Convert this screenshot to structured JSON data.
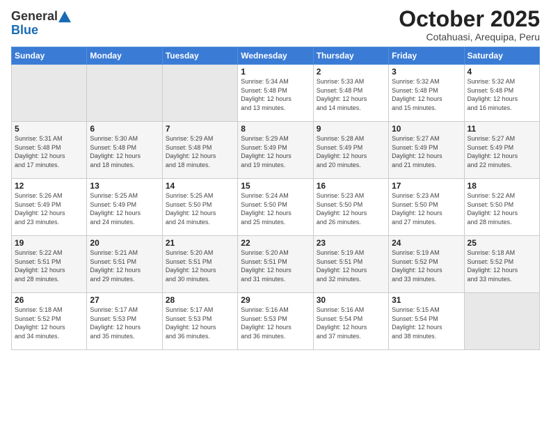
{
  "logo": {
    "general": "General",
    "blue": "Blue"
  },
  "header": {
    "title": "October 2025",
    "location": "Cotahuasi, Arequipa, Peru"
  },
  "weekdays": [
    "Sunday",
    "Monday",
    "Tuesday",
    "Wednesday",
    "Thursday",
    "Friday",
    "Saturday"
  ],
  "weeks": [
    [
      {
        "day": "",
        "info": ""
      },
      {
        "day": "",
        "info": ""
      },
      {
        "day": "",
        "info": ""
      },
      {
        "day": "1",
        "info": "Sunrise: 5:34 AM\nSunset: 5:48 PM\nDaylight: 12 hours\nand 13 minutes."
      },
      {
        "day": "2",
        "info": "Sunrise: 5:33 AM\nSunset: 5:48 PM\nDaylight: 12 hours\nand 14 minutes."
      },
      {
        "day": "3",
        "info": "Sunrise: 5:32 AM\nSunset: 5:48 PM\nDaylight: 12 hours\nand 15 minutes."
      },
      {
        "day": "4",
        "info": "Sunrise: 5:32 AM\nSunset: 5:48 PM\nDaylight: 12 hours\nand 16 minutes."
      }
    ],
    [
      {
        "day": "5",
        "info": "Sunrise: 5:31 AM\nSunset: 5:48 PM\nDaylight: 12 hours\nand 17 minutes."
      },
      {
        "day": "6",
        "info": "Sunrise: 5:30 AM\nSunset: 5:48 PM\nDaylight: 12 hours\nand 18 minutes."
      },
      {
        "day": "7",
        "info": "Sunrise: 5:29 AM\nSunset: 5:48 PM\nDaylight: 12 hours\nand 18 minutes."
      },
      {
        "day": "8",
        "info": "Sunrise: 5:29 AM\nSunset: 5:49 PM\nDaylight: 12 hours\nand 19 minutes."
      },
      {
        "day": "9",
        "info": "Sunrise: 5:28 AM\nSunset: 5:49 PM\nDaylight: 12 hours\nand 20 minutes."
      },
      {
        "day": "10",
        "info": "Sunrise: 5:27 AM\nSunset: 5:49 PM\nDaylight: 12 hours\nand 21 minutes."
      },
      {
        "day": "11",
        "info": "Sunrise: 5:27 AM\nSunset: 5:49 PM\nDaylight: 12 hours\nand 22 minutes."
      }
    ],
    [
      {
        "day": "12",
        "info": "Sunrise: 5:26 AM\nSunset: 5:49 PM\nDaylight: 12 hours\nand 23 minutes."
      },
      {
        "day": "13",
        "info": "Sunrise: 5:25 AM\nSunset: 5:49 PM\nDaylight: 12 hours\nand 24 minutes."
      },
      {
        "day": "14",
        "info": "Sunrise: 5:25 AM\nSunset: 5:50 PM\nDaylight: 12 hours\nand 24 minutes."
      },
      {
        "day": "15",
        "info": "Sunrise: 5:24 AM\nSunset: 5:50 PM\nDaylight: 12 hours\nand 25 minutes."
      },
      {
        "day": "16",
        "info": "Sunrise: 5:23 AM\nSunset: 5:50 PM\nDaylight: 12 hours\nand 26 minutes."
      },
      {
        "day": "17",
        "info": "Sunrise: 5:23 AM\nSunset: 5:50 PM\nDaylight: 12 hours\nand 27 minutes."
      },
      {
        "day": "18",
        "info": "Sunrise: 5:22 AM\nSunset: 5:50 PM\nDaylight: 12 hours\nand 28 minutes."
      }
    ],
    [
      {
        "day": "19",
        "info": "Sunrise: 5:22 AM\nSunset: 5:51 PM\nDaylight: 12 hours\nand 28 minutes."
      },
      {
        "day": "20",
        "info": "Sunrise: 5:21 AM\nSunset: 5:51 PM\nDaylight: 12 hours\nand 29 minutes."
      },
      {
        "day": "21",
        "info": "Sunrise: 5:20 AM\nSunset: 5:51 PM\nDaylight: 12 hours\nand 30 minutes."
      },
      {
        "day": "22",
        "info": "Sunrise: 5:20 AM\nSunset: 5:51 PM\nDaylight: 12 hours\nand 31 minutes."
      },
      {
        "day": "23",
        "info": "Sunrise: 5:19 AM\nSunset: 5:51 PM\nDaylight: 12 hours\nand 32 minutes."
      },
      {
        "day": "24",
        "info": "Sunrise: 5:19 AM\nSunset: 5:52 PM\nDaylight: 12 hours\nand 33 minutes."
      },
      {
        "day": "25",
        "info": "Sunrise: 5:18 AM\nSunset: 5:52 PM\nDaylight: 12 hours\nand 33 minutes."
      }
    ],
    [
      {
        "day": "26",
        "info": "Sunrise: 5:18 AM\nSunset: 5:52 PM\nDaylight: 12 hours\nand 34 minutes."
      },
      {
        "day": "27",
        "info": "Sunrise: 5:17 AM\nSunset: 5:53 PM\nDaylight: 12 hours\nand 35 minutes."
      },
      {
        "day": "28",
        "info": "Sunrise: 5:17 AM\nSunset: 5:53 PM\nDaylight: 12 hours\nand 36 minutes."
      },
      {
        "day": "29",
        "info": "Sunrise: 5:16 AM\nSunset: 5:53 PM\nDaylight: 12 hours\nand 36 minutes."
      },
      {
        "day": "30",
        "info": "Sunrise: 5:16 AM\nSunset: 5:54 PM\nDaylight: 12 hours\nand 37 minutes."
      },
      {
        "day": "31",
        "info": "Sunrise: 5:15 AM\nSunset: 5:54 PM\nDaylight: 12 hours\nand 38 minutes."
      },
      {
        "day": "",
        "info": ""
      }
    ]
  ]
}
